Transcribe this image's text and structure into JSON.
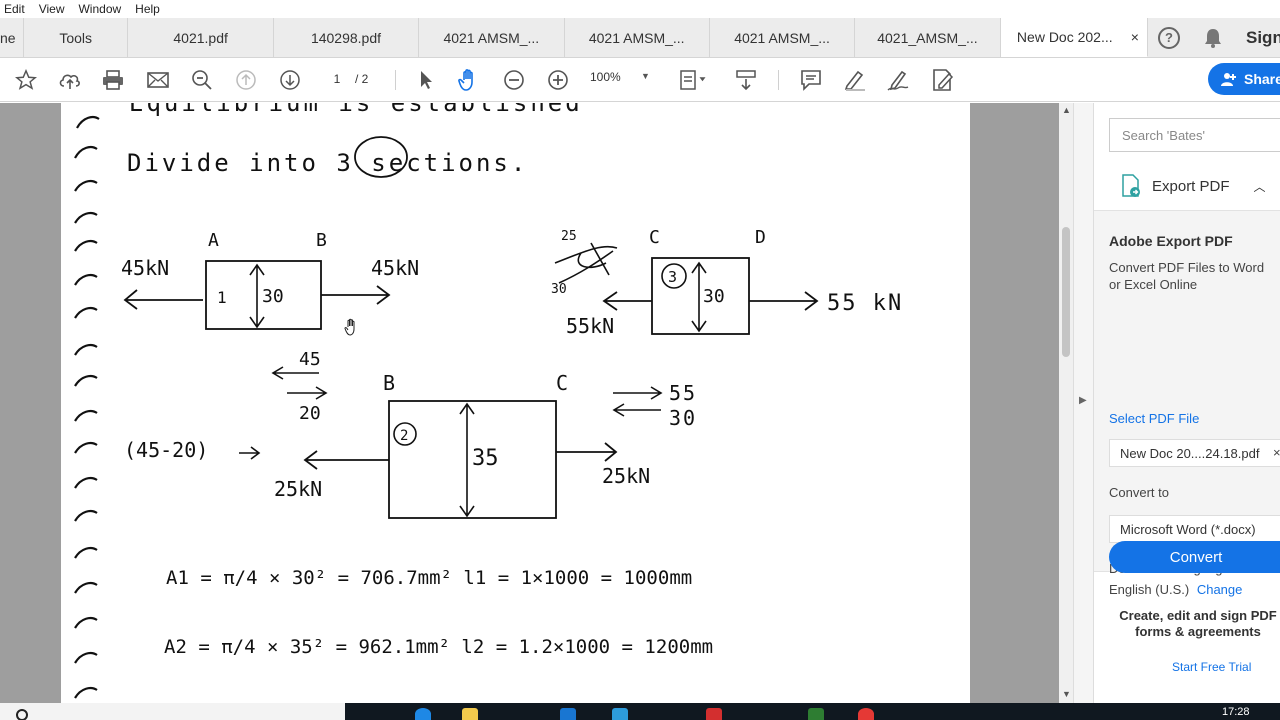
{
  "menu": {
    "items": [
      "Edit",
      "View",
      "Window",
      "Help"
    ]
  },
  "tabs": {
    "home": "ne",
    "tools": "Tools",
    "docs": [
      "4021.pdf",
      "140298.pdf",
      "4021 AMSM_...",
      "4021 AMSM_...",
      "4021 AMSM_...",
      "4021_AMSM_..."
    ],
    "active": "New Doc 202...",
    "close_glyph": "×",
    "help_glyph": "?",
    "sign_in": "Sign In"
  },
  "toolbar": {
    "page_current": "1",
    "page_total": "/ 2",
    "zoom": "100%",
    "share_label": "Share"
  },
  "right_pane": {
    "search_placeholder": "Search 'Bates'",
    "export_title": "Export PDF",
    "heading": "Adobe Export PDF",
    "description": "Convert PDF Files to Word or Excel Online",
    "select_file": "Select PDF File",
    "file_name": "New Doc 20....24.18.pdf",
    "convert_to_label": "Convert to",
    "format": "Microsoft Word (*.docx)",
    "doc_lang_label": "Document Language:",
    "doc_lang": "English (U.S.)",
    "change": "Change",
    "convert_button": "Convert",
    "promo": "Create, edit and sign PDF forms & agreements",
    "trial": "Start Free Trial"
  },
  "document": {
    "line1": "Equilibrium is established",
    "line2": "Divide into 3 sections.",
    "sec1": {
      "left": "A",
      "right": "B",
      "force_left": "45kN",
      "num": "1",
      "dim": "30"
    },
    "sec3": {
      "left": "C",
      "right": "D",
      "scribble": "25",
      "scribble2": "30",
      "force_left": "55kN",
      "force_right": "55 kN",
      "num": "3",
      "dim": "30"
    },
    "sec2": {
      "left": "B",
      "right": "C",
      "num": "2",
      "dim": "35",
      "force_left": "25kN",
      "force_right": "25kN",
      "expr": "(45-20)",
      "top_a": "45",
      "top_b": "20",
      "right_a": "55",
      "right_b": "30"
    },
    "eq1": "A1 = π/4 × 30² = 706.7mm²  l1 = 1×1000 = 1000mm",
    "eq2": "A2 = π/4 × 35² = 962.1mm²  l2 = 1.2×1000 = 1200mm"
  },
  "taskbar": {
    "clock": "17:28"
  },
  "colors": {
    "accent": "#1473e6",
    "doc_bg": "#9e9e9e",
    "tabbar_bg": "#ececec"
  }
}
